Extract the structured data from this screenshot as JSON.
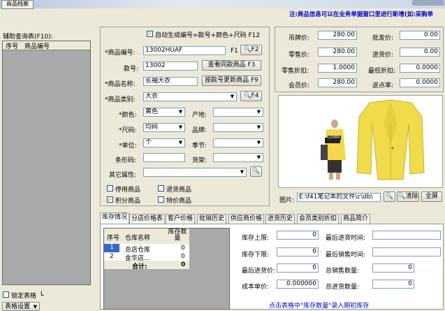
{
  "title_tab": "商品档案",
  "notice": "注:商品信息可以在业务单据窗口里进行新增(如:采购单",
  "left": {
    "header": "辅助查询表(F10):",
    "col_no": "序号",
    "col_code": "商品编号",
    "lock_label": "锁定表格",
    "lock_key": "L",
    "settings_label": "表格设置"
  },
  "form": {
    "autogen_label": "自动生成编号=款号+颜色+尺码 F12",
    "code_label": "*商品编号:",
    "code_value": "13002HUAF",
    "f1": "F1",
    "f2": "F2",
    "style_label": "款号:",
    "style_value": "13002",
    "same_style_btn": "查看同款商品 F3",
    "name_label": "*商品名称:",
    "name_value": "长袖大衣",
    "update_by_style_btn": "按款号更新商品 F9",
    "category_label": "*商品类别:",
    "category_value": "大衣",
    "f4": "F4",
    "color_label": "*颜色:",
    "color_value": "黄色",
    "origin_label": "产地:",
    "size_label": "*尺码:",
    "size_value": "均码",
    "brand_label": "品牌:",
    "unit_label": "*单位:",
    "unit_value": "个",
    "season_label": "季节:",
    "barcode_label": "条形码:",
    "shelf_label": "货架:",
    "other_label": "其它属性:",
    "chk_disabled": "停用商品",
    "chk_return": "退货商品",
    "chk_points": "积分商品",
    "chk_special": "特价商品"
  },
  "prices": {
    "tag_label": "吊牌价:",
    "tag_value": "280.00",
    "wholesale_label": "批发价:",
    "wholesale_value": "0.00",
    "retail_label": "零售价:",
    "retail_value": "280.00",
    "purchase_label": "进货价:",
    "purchase_value": "0.00",
    "discount_label": "零售折扣:",
    "discount_value": "1.0000",
    "min_discount_label": "最低折扣:",
    "min_discount_value": "0.0000",
    "member_label": "会员价:",
    "member_value": "280.00",
    "rebate_label": "返点率:",
    "rebate_value": "0.0000"
  },
  "image": {
    "path_label": "图片:",
    "path_value": "E:\\f41笔记本的文件\\c\\db\\",
    "clear_btn": "清除",
    "fullscreen_btn": "全屏",
    "tag_text": "LOVER"
  },
  "tabs": [
    "库存情况",
    "分店价格表",
    "客户价格",
    "批销历史",
    "供应商价格",
    "进货历史",
    "会员类别折扣",
    "商品简介"
  ],
  "stock_table": {
    "headers": [
      "序号",
      "仓库名称",
      "库存数量"
    ],
    "rows": [
      {
        "no": "1",
        "name": "总店仓库",
        "qty": "0"
      },
      {
        "no": "2",
        "name": "金华店...",
        "qty": "0"
      }
    ],
    "total_label": "合计:",
    "total_value": "0"
  },
  "stock_info": {
    "upper_label": "库存上限:",
    "upper_value": "0",
    "lower_label": "库存下限:",
    "lower_value": "0",
    "last_price_label": "最后进货价:",
    "last_price_value": "0",
    "cost_label": "成本单价:",
    "cost_value": "0.000000",
    "last_in_label": "最后进货时间:",
    "last_sale_label": "最后销售时间:",
    "total_sale_label": "总销售数量:",
    "total_sale_value": "0",
    "total_in_label": "总进货数量:",
    "total_in_value": "0"
  },
  "hint": "点击表格中\"库存数量\"录入期初库存",
  "colors": {
    "accent_blue": "#0000cc",
    "window_bg": "#ece9d8"
  }
}
